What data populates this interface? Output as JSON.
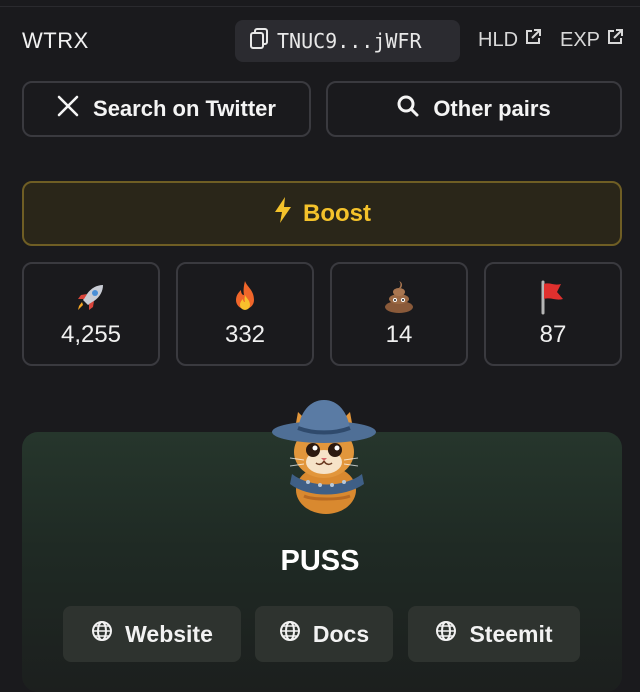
{
  "pair": {
    "name": "WTRX",
    "address": "TNUC9...jWFR",
    "links": [
      {
        "label": "HLD",
        "icon": "external-link-icon"
      },
      {
        "label": "EXP",
        "icon": "external-link-icon"
      }
    ]
  },
  "actions": {
    "twitter_label": "Search on Twitter",
    "pairs_label": "Other pairs",
    "boost_label": "Boost"
  },
  "reactions": [
    {
      "icon": "rocket-icon",
      "count": "4,255"
    },
    {
      "icon": "fire-icon",
      "count": "332"
    },
    {
      "icon": "poop-icon",
      "count": "14"
    },
    {
      "icon": "red-flag-icon",
      "count": "87"
    }
  ],
  "token": {
    "name": "PUSS",
    "links": [
      {
        "label": "Website",
        "icon": "globe-icon"
      },
      {
        "label": "Docs",
        "icon": "globe-icon"
      },
      {
        "label": "Steemit",
        "icon": "globe-icon"
      }
    ]
  },
  "colors": {
    "background": "#1a1a1d",
    "boost_accent": "#f4c22b",
    "card_green": "#26362c"
  }
}
